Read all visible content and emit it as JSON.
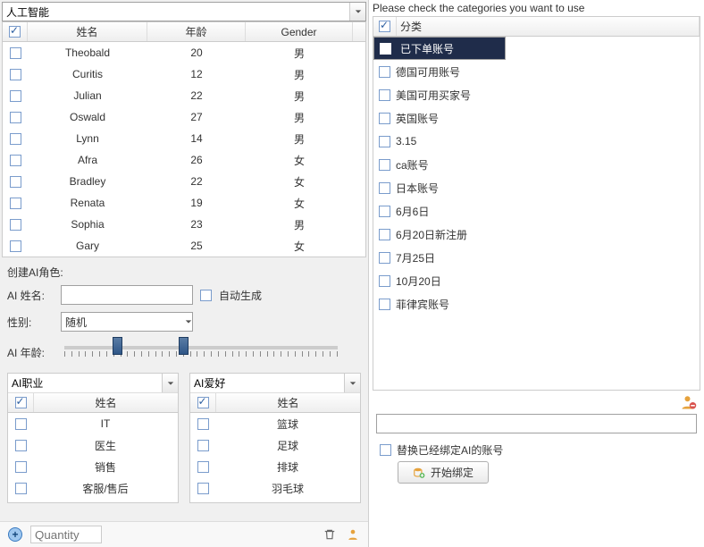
{
  "left": {
    "top_combo_value": "人工智能",
    "columns": [
      "姓名",
      "年龄",
      "Gender"
    ],
    "rows": [
      {
        "name": "Theobald",
        "age": "20",
        "gender": "男"
      },
      {
        "name": "Curitis",
        "age": "12",
        "gender": "男"
      },
      {
        "name": "Julian",
        "age": "22",
        "gender": "男"
      },
      {
        "name": "Oswald",
        "age": "27",
        "gender": "男"
      },
      {
        "name": "Lynn",
        "age": "14",
        "gender": "男"
      },
      {
        "name": "Afra",
        "age": "26",
        "gender": "女"
      },
      {
        "name": "Bradley",
        "age": "22",
        "gender": "女"
      },
      {
        "name": "Renata",
        "age": "19",
        "gender": "女"
      },
      {
        "name": "Sophia",
        "age": "23",
        "gender": "男"
      },
      {
        "name": "Gary",
        "age": "25",
        "gender": "女"
      }
    ],
    "create_title": "创建AI角色:",
    "name_label": "AI 姓名:",
    "auto_label": "自动生成",
    "gender_label": "性别:",
    "gender_value": "随机",
    "age_label": "AI 年龄:",
    "job_combo": "AI职业",
    "hobby_combo": "AI爱好",
    "mini_col": "姓名",
    "jobs": [
      "IT",
      "医生",
      "销售",
      "客服/售后"
    ],
    "hobbies": [
      "篮球",
      "足球",
      "排球",
      "羽毛球"
    ],
    "qty_placeholder": "Quantity"
  },
  "right": {
    "title": "Please check the categories you want to use",
    "cat_header": "分类",
    "categories": [
      {
        "label": "已下单账号",
        "checked": true,
        "selected": true
      },
      {
        "label": "德国可用账号",
        "checked": false
      },
      {
        "label": "美国可用买家号",
        "checked": false
      },
      {
        "label": "英国账号",
        "checked": false
      },
      {
        "label": "3.15",
        "checked": false
      },
      {
        "label": "ca账号",
        "checked": false
      },
      {
        "label": "日本账号",
        "checked": false
      },
      {
        "label": "6月6日",
        "checked": false
      },
      {
        "label": "6月20日新注册",
        "checked": false
      },
      {
        "label": "7月25日",
        "checked": false
      },
      {
        "label": "10月20日",
        "checked": false
      },
      {
        "label": "菲律宾账号",
        "checked": false
      }
    ],
    "replace_label": "替换已经绑定AI的账号",
    "bind_button": "开始绑定"
  }
}
